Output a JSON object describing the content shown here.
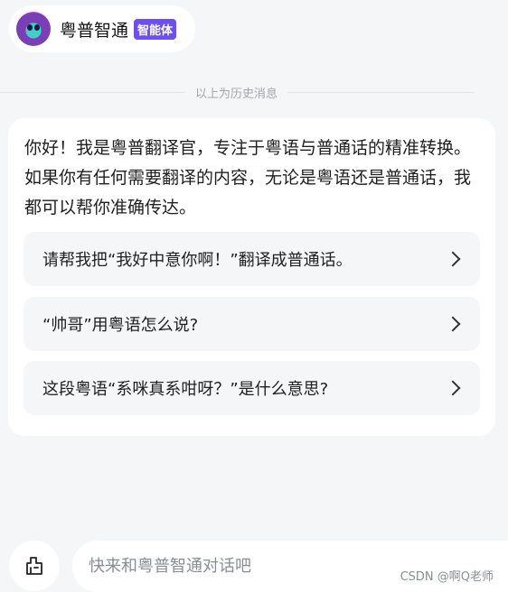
{
  "header": {
    "bot_name": "粤普智通",
    "badge": "智能体",
    "avatar_icon": "robot-avatar-icon"
  },
  "divider": {
    "text": "以上为历史消息"
  },
  "card": {
    "intro": "你好！我是粤普翻译官，专注于粤语与普通话的精准转换。如果你有任何需要翻译的内容，无论是粤语还是普通话，我都可以帮你准确传达。",
    "suggestions": [
      {
        "label": "请帮我把“我好中意你啊！”翻译成普通话。",
        "icon": "chevron-right-icon"
      },
      {
        "label": "“帅哥”用粤语怎么说?",
        "icon": "chevron-right-icon"
      },
      {
        "label": "这段粤语“系咪真系咁呀？”是什么意思?",
        "icon": "chevron-right-icon"
      }
    ]
  },
  "composer": {
    "new_chat_icon": "new-chat-icon",
    "placeholder": "快来和粤普智通对话吧"
  },
  "watermark": "CSDN @啊Q老师",
  "colors": {
    "background": "#f5f6f8",
    "badge": "#6c4ef2",
    "card": "#ffffff"
  }
}
